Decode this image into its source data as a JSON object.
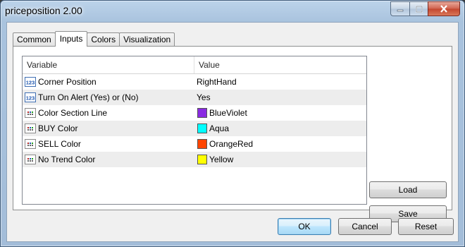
{
  "window": {
    "title": "priceposition 2.00"
  },
  "tabs": [
    {
      "label": "Common",
      "active": false
    },
    {
      "label": "Inputs",
      "active": true
    },
    {
      "label": "Colors",
      "active": false
    },
    {
      "label": "Visualization",
      "active": false
    }
  ],
  "grid": {
    "headers": {
      "variable": "Variable",
      "value": "Value"
    },
    "rows": [
      {
        "type": "number",
        "icon": "number-123-icon",
        "variable": "Corner Position",
        "value": "RightHand"
      },
      {
        "type": "number",
        "icon": "number-123-icon",
        "variable": "Turn On Alert (Yes) or (No)",
        "value": "Yes"
      },
      {
        "type": "color",
        "icon": "color-grid-icon",
        "variable": "Color Section Line",
        "value": "BlueViolet",
        "color": "#8a2be2"
      },
      {
        "type": "color",
        "icon": "color-grid-icon",
        "variable": "BUY Color",
        "value": "Aqua",
        "color": "#00ffff"
      },
      {
        "type": "color",
        "icon": "color-grid-icon",
        "variable": "SELL Color",
        "value": "OrangeRed",
        "color": "#ff4500"
      },
      {
        "type": "color",
        "icon": "color-grid-icon",
        "variable": "No Trend Color",
        "value": "Yellow",
        "color": "#ffff00"
      }
    ]
  },
  "side_buttons": {
    "load": "Load",
    "save": "Save"
  },
  "footer_buttons": {
    "ok": "OK",
    "cancel": "Cancel",
    "reset": "Reset"
  }
}
